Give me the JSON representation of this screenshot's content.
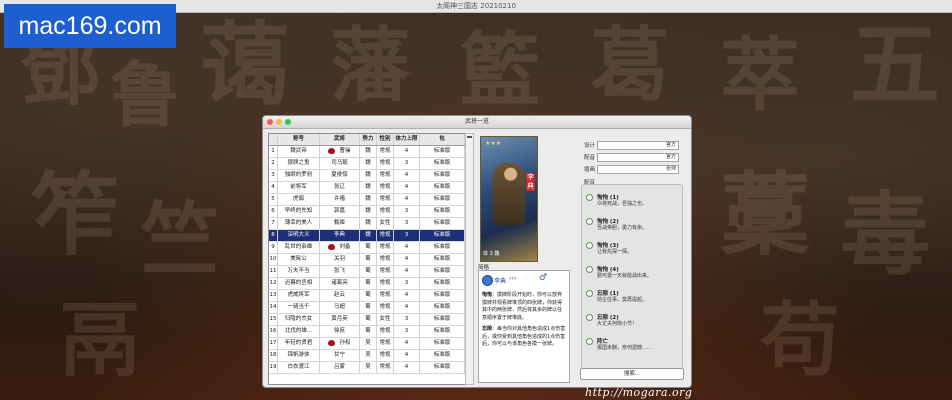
{
  "app_title": "太阁神三国志 20210210",
  "watermark_top": "mac169.com",
  "watermark_bottom": "http://mogara.org",
  "window": {
    "title": "武将一览"
  },
  "table": {
    "headers": [
      "",
      "称号",
      "武将",
      "势力",
      "体力上限",
      "包"
    ],
    "rows": [
      [
        "1",
        "魏武帝",
        "曹操",
        "魏",
        "常规",
        "4",
        "标准版"
      ],
      [
        "2",
        "狼顾之鬼",
        "司马懿",
        "魏",
        "常规",
        "3",
        "标准版"
      ],
      [
        "3",
        "独眼的罗刹",
        "夏侯惇",
        "魏",
        "常规",
        "4",
        "标准版"
      ],
      [
        "4",
        "前将军",
        "张辽",
        "魏",
        "常规",
        "4",
        "标准版"
      ],
      [
        "5",
        "虎痴",
        "许褚",
        "魏",
        "常规",
        "4",
        "标准版"
      ],
      [
        "6",
        "早终的先知",
        "郭嘉",
        "魏",
        "常规",
        "3",
        "标准版"
      ],
      [
        "7",
        "薄幸的美人",
        "甄姬",
        "魏",
        "女性",
        "3",
        "标准版"
      ],
      [
        "8",
        "深明大义",
        "李典",
        "魏",
        "常规",
        "3",
        "标准版"
      ],
      [
        "9",
        "乱世的枭雄",
        "刘备",
        "蜀",
        "常规",
        "4",
        "标准版"
      ],
      [
        "10",
        "美髯公",
        "关羽",
        "蜀",
        "常规",
        "4",
        "标准版"
      ],
      [
        "11",
        "万夫不当",
        "张飞",
        "蜀",
        "常规",
        "4",
        "标准版"
      ],
      [
        "12",
        "迟暮的丞相",
        "诸葛亮",
        "蜀",
        "常规",
        "3",
        "标准版"
      ],
      [
        "13",
        "虎威将军",
        "赵云",
        "蜀",
        "常规",
        "4",
        "标准版"
      ],
      [
        "14",
        "一骑当千",
        "马超",
        "蜀",
        "常规",
        "4",
        "标准版"
      ],
      [
        "15",
        "归隐的杰女",
        "黄月英",
        "蜀",
        "女性",
        "3",
        "标准版"
      ],
      [
        "16",
        "北伐的雄...",
        "徐庶",
        "蜀",
        "常规",
        "3",
        "标准版"
      ],
      [
        "17",
        "年轻的贤君",
        "孙权",
        "吴",
        "常规",
        "4",
        "标准版"
      ],
      [
        "18",
        "锦帆游侠",
        "甘宁",
        "吴",
        "常规",
        "4",
        "标准版"
      ],
      [
        "19",
        "白衣渡江",
        "吕蒙",
        "吴",
        "常规",
        "4",
        "标准版"
      ]
    ],
    "selected_index": 8,
    "lord_rows": [
      1,
      9,
      17
    ]
  },
  "card": {
    "stars": "★★★",
    "name": "李典",
    "stats": "体 3  魏"
  },
  "detail": {
    "label": "简略",
    "general_name": "李典",
    "arrows": "›››",
    "gender_symbol": "♂",
    "skills": [
      {
        "name": "恂恂",
        "text": "摸牌阶段开始时，你可以放弃摸牌并观看牌堆顶的四张牌，你获得其中的两张牌，然后将其余的牌以任意顺序置于牌堆底。"
      },
      {
        "name": "忘隙",
        "text": "每当你对其他角色造成1点伤害后，或你受到其他角色造成的1点伤害后，你可以与该角色各摸一张牌。"
      }
    ]
  },
  "form": {
    "design_label": "设计",
    "design_btn": "官方",
    "cv_label": "配音",
    "cv_btn": "官方",
    "illustrator_label": "插画",
    "illustrator_btn": "张帅"
  },
  "voice": {
    "group_label": "配音",
    "options": [
      {
        "title": "恂恂 (1)",
        "desc": "众将死战，吾独之也。"
      },
      {
        "title": "恂恂 (2)",
        "desc": "吾战英胆，勇力有余。"
      },
      {
        "title": "恂恂 (3)",
        "desc": "让我先探一探。"
      },
      {
        "title": "恂恂 (4)",
        "desc": "勤可勇一天就能战出来。"
      },
      {
        "title": "忘隙 (1)",
        "desc": "前尘往事，莫再提起。"
      },
      {
        "title": "忘隙 (2)",
        "desc": "大丈夫何拘小节！"
      },
      {
        "title": "阵亡",
        "desc": "报国未酬，奈何遗憾……"
      }
    ]
  },
  "search_button": "搜索..."
}
